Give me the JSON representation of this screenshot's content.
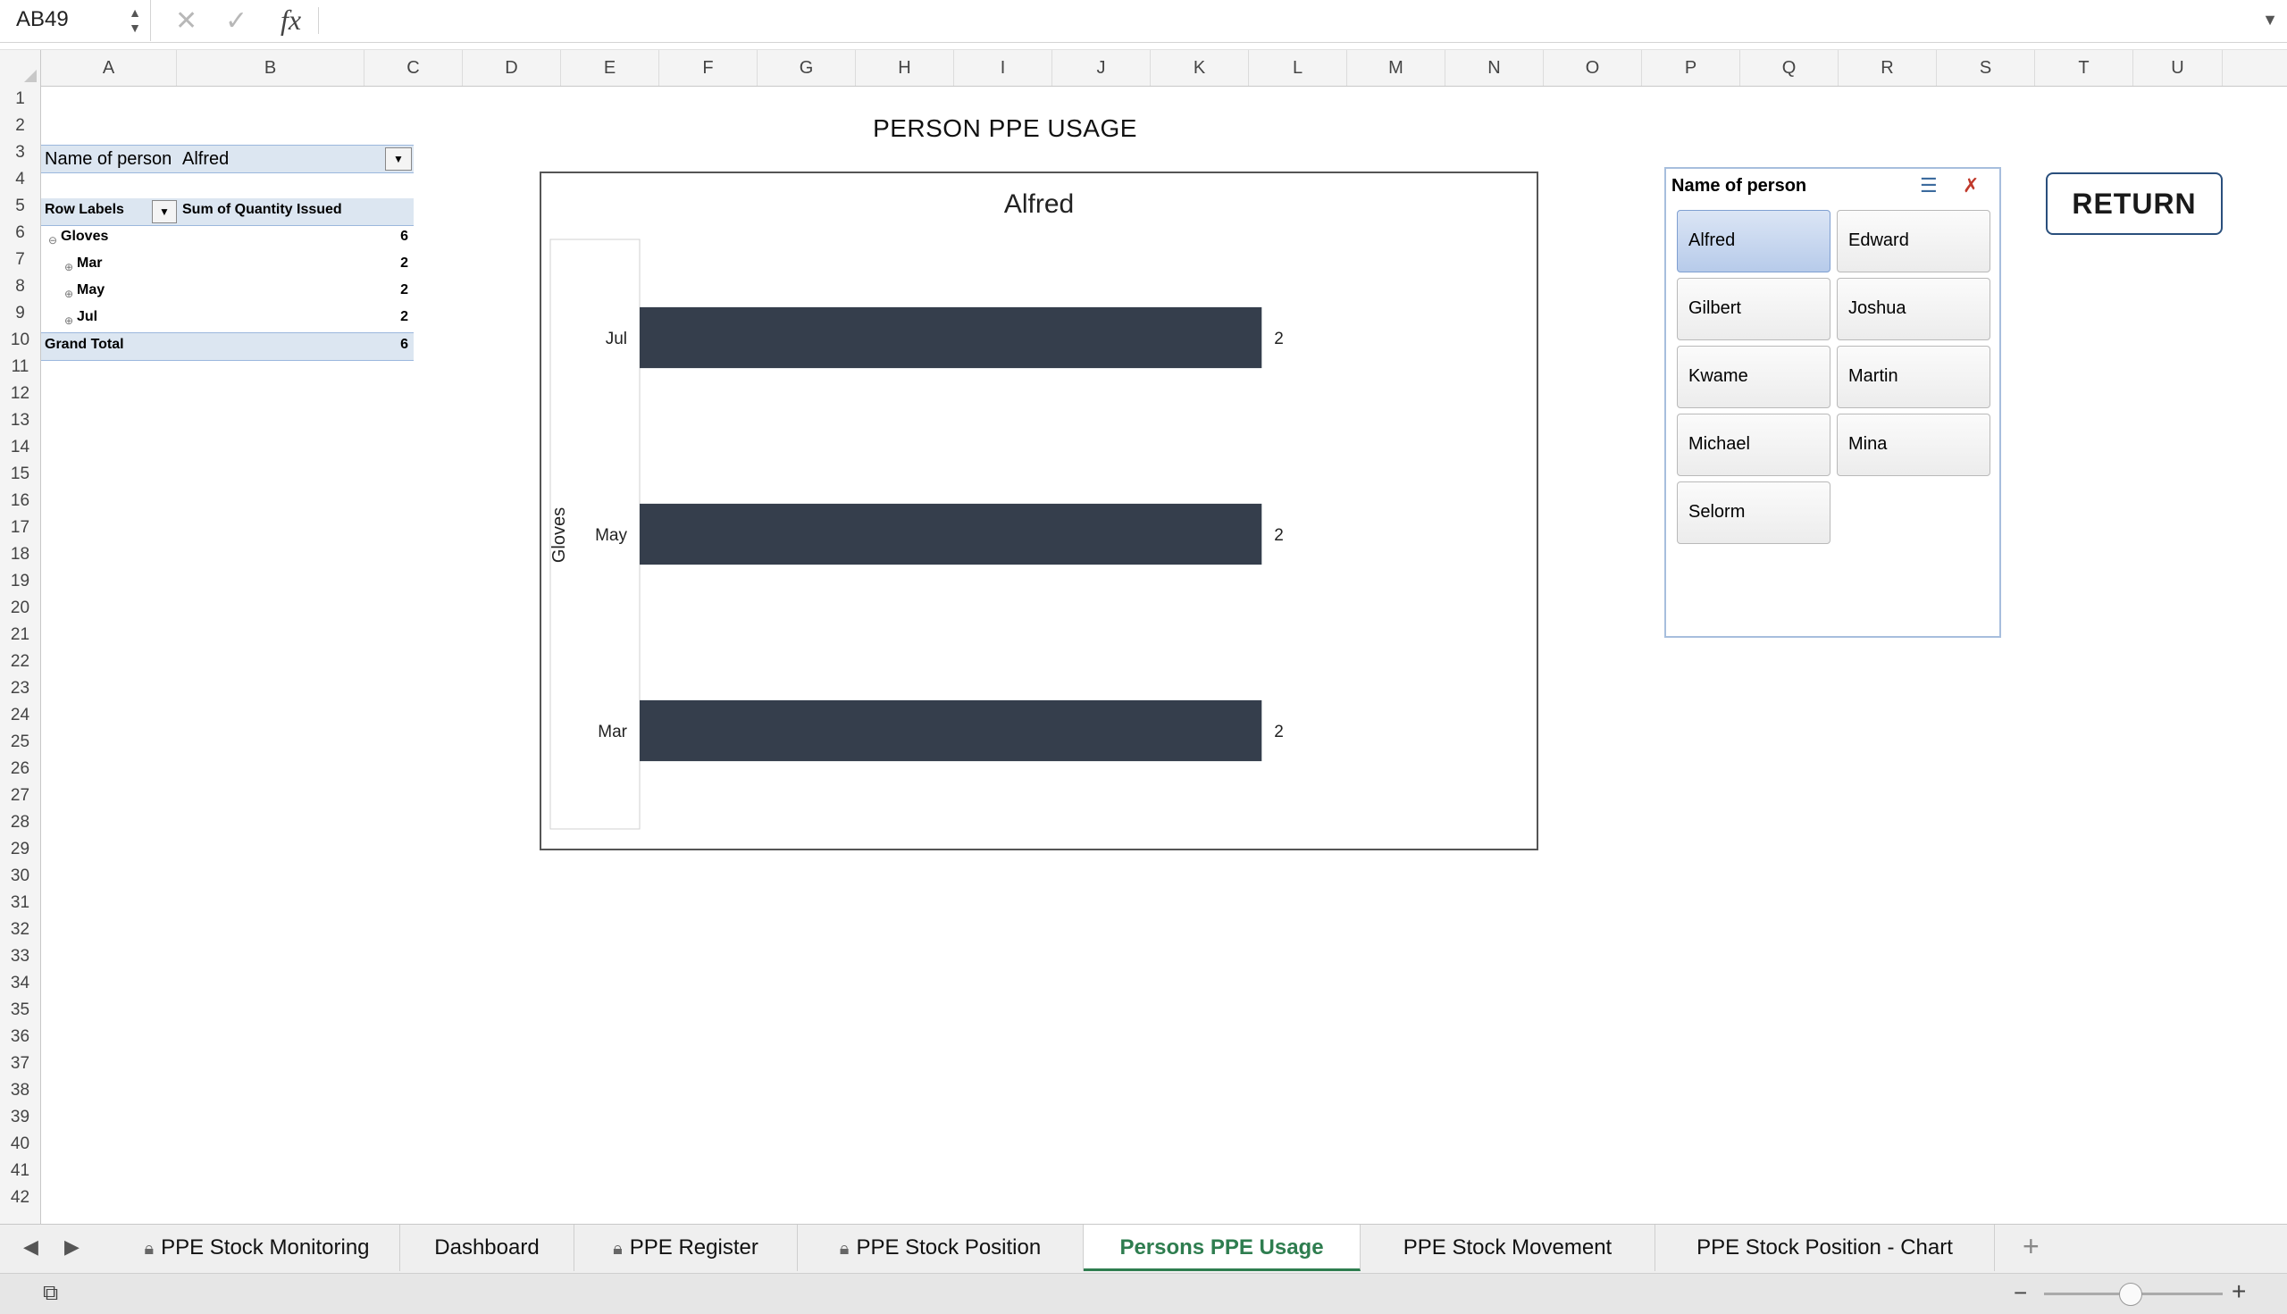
{
  "formula_bar": {
    "cell_ref": "AB49",
    "fx_label": "fx",
    "formula": ""
  },
  "columns": [
    "A",
    "B",
    "C",
    "D",
    "E",
    "F",
    "G",
    "H",
    "I",
    "J",
    "K",
    "L",
    "M",
    "N",
    "O",
    "P",
    "Q",
    "R",
    "S",
    "T",
    "U"
  ],
  "rows": [
    "1",
    "2",
    "3",
    "4",
    "5",
    "6",
    "7",
    "8",
    "9",
    "10",
    "11",
    "12",
    "13",
    "14",
    "15",
    "16",
    "17",
    "18",
    "19",
    "20",
    "21",
    "22",
    "23",
    "24",
    "25",
    "26",
    "27",
    "28",
    "29",
    "30",
    "31",
    "32",
    "33",
    "34",
    "35",
    "36",
    "37",
    "38",
    "39",
    "40",
    "41",
    "42"
  ],
  "pivot": {
    "filter_label": "Name of person",
    "filter_value": "Alfred",
    "col1_header": "Row Labels",
    "col2_header": "Sum of Quantity Issued",
    "group_label": "Gloves",
    "group_value": "6",
    "months": [
      {
        "label": "Mar",
        "value": "2"
      },
      {
        "label": "May",
        "value": "2"
      },
      {
        "label": "Jul",
        "value": "2"
      }
    ],
    "total_label": "Grand Total",
    "total_value": "6"
  },
  "sheet_title": "PERSON PPE USAGE",
  "chart_data": {
    "type": "bar",
    "orientation": "horizontal",
    "title": "Alfred",
    "group_label": "Gloves",
    "categories": [
      "Jul",
      "May",
      "Mar"
    ],
    "values": [
      2,
      2,
      2
    ],
    "data_labels": [
      "2",
      "2",
      "2"
    ],
    "bar_color": "#353e4c",
    "xlim": [
      0,
      2.7
    ],
    "grid": false,
    "legend": "none"
  },
  "slicer": {
    "title": "Name of person",
    "items": [
      {
        "label": "Alfred",
        "selected": true
      },
      {
        "label": "Edward",
        "selected": false
      },
      {
        "label": "Gilbert",
        "selected": false
      },
      {
        "label": "Joshua",
        "selected": false
      },
      {
        "label": "Kwame",
        "selected": false
      },
      {
        "label": "Martin",
        "selected": false
      },
      {
        "label": "Michael",
        "selected": false
      },
      {
        "label": "Mina",
        "selected": false
      },
      {
        "label": "Selorm",
        "selected": false
      }
    ]
  },
  "return_button": "RETURN",
  "tabs": [
    {
      "label": "PPE Stock Monitoring",
      "locked": true,
      "active": false
    },
    {
      "label": "Dashboard",
      "locked": false,
      "active": false
    },
    {
      "label": "PPE Register",
      "locked": true,
      "active": false
    },
    {
      "label": "PPE Stock Position",
      "locked": true,
      "active": false
    },
    {
      "label": "Persons PPE Usage",
      "locked": false,
      "active": true
    },
    {
      "label": "PPE Stock Movement",
      "locked": false,
      "active": false
    },
    {
      "label": "PPE Stock Position - Chart",
      "locked": false,
      "active": false
    }
  ]
}
